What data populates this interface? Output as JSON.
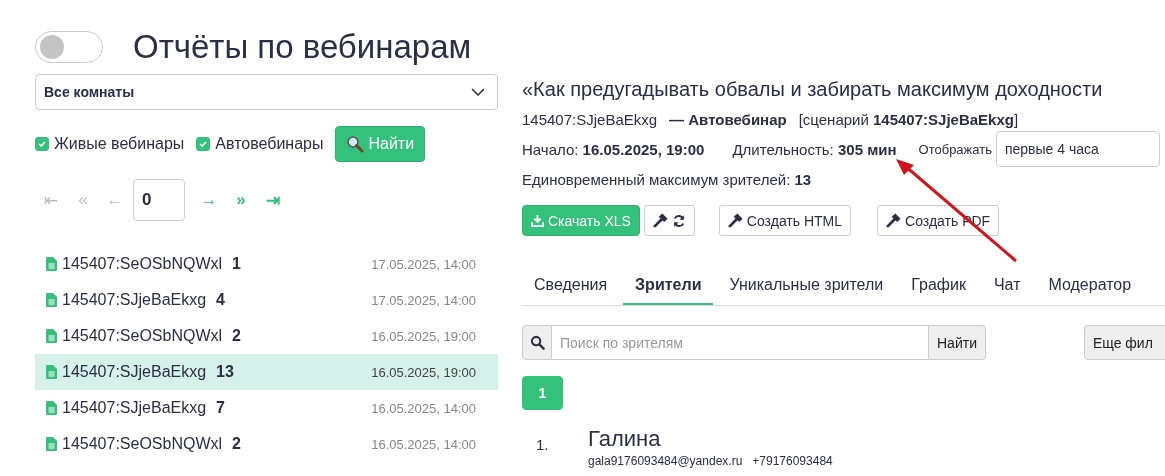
{
  "toggle": {
    "on": false
  },
  "title": "Отчёты по вебинарам",
  "room_select": {
    "value": "Все комнаты"
  },
  "filters": [
    {
      "label": "Живые вебинары",
      "checked": true
    },
    {
      "label": "Автовебинары",
      "checked": true
    }
  ],
  "find_button": "Найти",
  "pager": [
    {
      "kind": "button",
      "label": "⇤",
      "disabled": true
    },
    {
      "kind": "button",
      "label": "«",
      "disabled": true
    },
    {
      "kind": "button",
      "label": "←",
      "disabled": true
    },
    {
      "kind": "input",
      "value": "0"
    },
    {
      "kind": "button",
      "label": "→",
      "disabled": false
    },
    {
      "kind": "button",
      "label": "»",
      "disabled": false
    },
    {
      "kind": "button",
      "label": "⇥",
      "disabled": false
    }
  ],
  "webinars": [
    {
      "name": "145407:SeOSbNQWxl",
      "count": "1",
      "date": "17.05.2025, 14:00",
      "selected": false
    },
    {
      "name": "145407:SJjeBaEkxg",
      "count": "4",
      "date": "17.05.2025, 14:00",
      "selected": false
    },
    {
      "name": "145407:SeOSbNQWxl",
      "count": "2",
      "date": "16.05.2025, 19:00",
      "selected": false
    },
    {
      "name": "145407:SJjeBaEkxg",
      "count": "13",
      "date": "16.05.2025, 19:00",
      "selected": true
    },
    {
      "name": "145407:SJjeBaEkxg",
      "count": "7",
      "date": "16.05.2025, 14:00",
      "selected": false
    },
    {
      "name": "145407:SeOSbNQWxl",
      "count": "2",
      "date": "16.05.2025, 14:00",
      "selected": false
    }
  ],
  "report": {
    "title": "«Как предугадывать обвалы и забирать максимум доходности",
    "id": "145407:SJjeBaEkxg",
    "type": "— Автовебинар",
    "scenario": "[сценарий **145407:SJjeBaEkxg**]",
    "start": "Начало: **16.05.2025, 19:00**",
    "duration": "Длительность: **305 мин**",
    "display_label": "Отображать",
    "display_value": "первые 4 часа",
    "max_viewers": "Единовременный максимум зрителей: **13**",
    "actions": [
      {
        "kind": "download",
        "label": "Скачать XLS"
      },
      {
        "kind": "rebuild"
      },
      {
        "kind": "create",
        "label": "Создать HTML"
      },
      {
        "kind": "create",
        "label": "Создать PDF"
      }
    ],
    "tabs": [
      {
        "label": "Сведения",
        "selected": false
      },
      {
        "label": "Зрители",
        "selected": true
      },
      {
        "label": "Уникальные зрители",
        "selected": false
      },
      {
        "label": "График",
        "selected": false
      },
      {
        "label": "Чат",
        "selected": false
      },
      {
        "label": "Модератор",
        "selected": false
      }
    ],
    "search": {
      "placeholder": "Поиск по зрителям",
      "button": "Найти"
    },
    "more_filters": "Еще фил",
    "pages": [
      {
        "label": "1",
        "selected": true
      }
    ],
    "viewers": [
      {
        "number": "1.",
        "name": "Галина",
        "email": "gala9176093484@yandex.ru",
        "phone": "+79176093484"
      }
    ]
  }
}
